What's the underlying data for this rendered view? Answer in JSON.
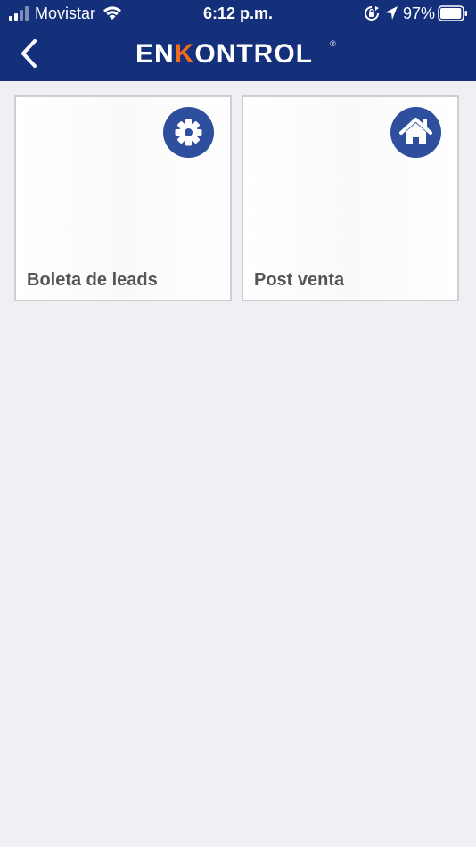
{
  "status_bar": {
    "carrier": "Movistar",
    "time": "6:12 p.m.",
    "battery_percent": "97%",
    "battery_level": 0.97,
    "icons": [
      "signal-icon",
      "wifi-icon",
      "rotation-lock-icon",
      "location-arrow-icon",
      "battery-icon"
    ]
  },
  "header": {
    "logo_prefix": "EN",
    "logo_k": "K",
    "logo_suffix": "ONTROL",
    "logo_reg": "®",
    "back_icon": "chevron-left-icon"
  },
  "colors": {
    "header_bg": "#14307a",
    "accent_orange": "#f26a1b",
    "icon_circle": "#2e4f9e",
    "page_bg": "#efeff4",
    "card_label": "#555555"
  },
  "cards": [
    {
      "label": "Boleta de leads",
      "icon": "gear-icon"
    },
    {
      "label": "Post venta",
      "icon": "home-icon"
    }
  ]
}
